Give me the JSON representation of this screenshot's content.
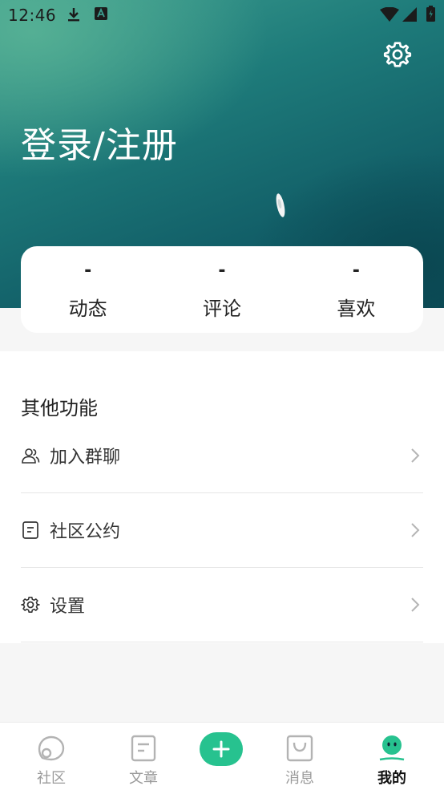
{
  "status_bar": {
    "time": "12:46"
  },
  "header": {
    "title": "登录/注册"
  },
  "stats": [
    {
      "value": "-",
      "label": "动态"
    },
    {
      "value": "-",
      "label": "评论"
    },
    {
      "value": "-",
      "label": "喜欢"
    }
  ],
  "other": {
    "title": "其他功能",
    "items": [
      {
        "label": "加入群聊",
        "icon": "group-icon"
      },
      {
        "label": "社区公约",
        "icon": "document-icon"
      },
      {
        "label": "设置",
        "icon": "gear-icon"
      }
    ]
  },
  "tabbar": {
    "tabs": [
      {
        "label": "社区",
        "icon": "community-icon"
      },
      {
        "label": "文章",
        "icon": "article-icon"
      },
      {
        "label": "消息",
        "icon": "message-bag-icon"
      },
      {
        "label": "我的",
        "icon": "profile-face-icon"
      }
    ],
    "add_icon": "plus-icon"
  },
  "colors": {
    "accent": "#27c28f",
    "hero_dark": "#0c4d5a",
    "hero_light": "#3c9c8e",
    "background": "#f6f6f6"
  }
}
